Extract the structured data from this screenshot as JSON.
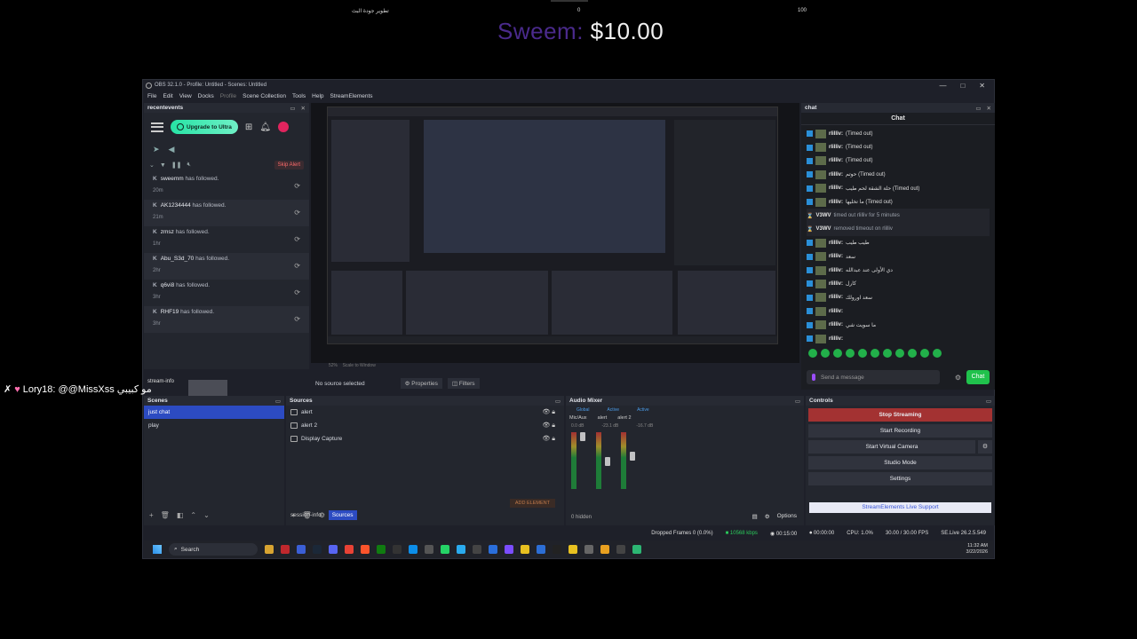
{
  "overlay": {
    "arabic_text": "تطوير جودة البث",
    "count_left": "0",
    "count_right": "100",
    "donation_name": "Sweem:",
    "donation_amount": "$10.00",
    "user_line_name": "Lory18:",
    "user_line_mention": "@@MissXss",
    "user_line_text": "مو كبيبي"
  },
  "window": {
    "title": "OBS 32.1.0 - Profile: Untitled - Scenes: Untitled",
    "controls": [
      "—",
      "□",
      "✕"
    ]
  },
  "menu": [
    "File",
    "Edit",
    "View",
    "Docks",
    "Profile",
    "Scene Collection",
    "Tools",
    "Help",
    "StreamElements"
  ],
  "recent": {
    "title": "recentevents",
    "upgrade_label": "Upgrade to Ultra",
    "skip_label": "Skip Alert",
    "events": [
      {
        "name": "sweemm",
        "text": "has followed.",
        "ago": "20m"
      },
      {
        "name": "AK1234444",
        "text": "has followed.",
        "ago": "21m"
      },
      {
        "name": "zmsz",
        "text": "has followed.",
        "ago": "1hr"
      },
      {
        "name": "Abu_S3d_70",
        "text": "has followed.",
        "ago": "2hr"
      },
      {
        "name": "q6vi8",
        "text": "has followed.",
        "ago": "3hr"
      },
      {
        "name": "RHF19",
        "text": "has followed.",
        "ago": "3hr"
      }
    ]
  },
  "preview": {
    "zoom": "52%",
    "zoom_mode": "Scale to Window",
    "source_status": "No source selected",
    "properties_label": "Properties",
    "filters_label": "Filters"
  },
  "chat": {
    "dock_title": "chat",
    "header": "Chat",
    "messages": [
      {
        "user": "rlilliv:",
        "text": "(Timed out)",
        "sys": false
      },
      {
        "user": "rlilliv:",
        "text": "(Timed out)",
        "sys": false
      },
      {
        "user": "rlilliv:",
        "text": "(Timed out)",
        "sys": false
      },
      {
        "user": "rlilliv:",
        "text": "حوتم (Timed out)",
        "sys": false
      },
      {
        "user": "rlilliv:",
        "text": "حلة الشقة لحم طيب (Timed out)",
        "sys": false
      },
      {
        "user": "rlilliv:",
        "text": "ما تخليها (Timed out)",
        "sys": false
      },
      {
        "user": "V3WV",
        "text": "timed out rlilliv for 5 minutes",
        "sys": true
      },
      {
        "user": "V3WV",
        "text": "removed timeout on rlilliv",
        "sys": true
      },
      {
        "user": "rlilliv:",
        "text": "طيب طيب",
        "sys": false
      },
      {
        "user": "rlilliv:",
        "text": "سعد",
        "sys": false
      },
      {
        "user": "rlilliv:",
        "text": "دي الأولى عند عبدالله",
        "sys": false
      },
      {
        "user": "rlilliv:",
        "text": "كارل",
        "sys": false
      },
      {
        "user": "rlilliv:",
        "text": "سعد اورولك",
        "sys": false
      },
      {
        "user": "rlilliv:",
        "text": "",
        "sys": false
      },
      {
        "user": "rlilliv:",
        "text": "ما سويت شي",
        "sys": false
      },
      {
        "user": "rlilliv:",
        "text": "",
        "sys": false
      }
    ],
    "input_placeholder": "Send a message",
    "send_label": "Chat"
  },
  "scenes": {
    "title": "Scenes",
    "items": [
      "just chat",
      "play"
    ],
    "selected": "just chat"
  },
  "sources": {
    "title": "Sources",
    "items": [
      "alert",
      "alert 2",
      "Display Capture"
    ],
    "add_element": "ADD ELEMENT",
    "tabs": [
      "session-info",
      "Sources"
    ],
    "stream_info_tab": "stream-info"
  },
  "mixer": {
    "title": "Audio Mixer",
    "tabs": [
      "Global",
      "Active",
      "Active"
    ],
    "channels": [
      {
        "name": "Mic/Aux",
        "db": "0.0 dB"
      },
      {
        "name": "alert",
        "db": "-23.1 dB"
      },
      {
        "name": "alert 2",
        "db": "-16.7 dB"
      }
    ],
    "hidden": "0 hidden",
    "options_label": "Options"
  },
  "controls": {
    "title": "Controls",
    "stop_streaming": "Stop Streaming",
    "start_recording": "Start Recording",
    "start_virtual_camera": "Start Virtual Camera",
    "studio_mode": "Studio Mode",
    "settings": "Settings",
    "se_support": "StreamElements Live Support"
  },
  "status": {
    "dropped": "Dropped Frames 0 (0.0%)",
    "kbps": "10568 kbps",
    "stream_time": "00:15:00",
    "rec_time": "00:00:00",
    "cpu": "CPU: 1.0%",
    "fps": "30.00 / 30.00 FPS",
    "se_version": "SE.Live 26.2.5.549"
  },
  "taskbar": {
    "search_label": "Search",
    "time": "11:32 AM",
    "date": "3/22/2026"
  },
  "colors": {
    "accent_blue": "#2c4bc2",
    "stop_red": "#a33232",
    "chat_green": "#20c24c",
    "donation_purple": "#4a2a8c"
  }
}
